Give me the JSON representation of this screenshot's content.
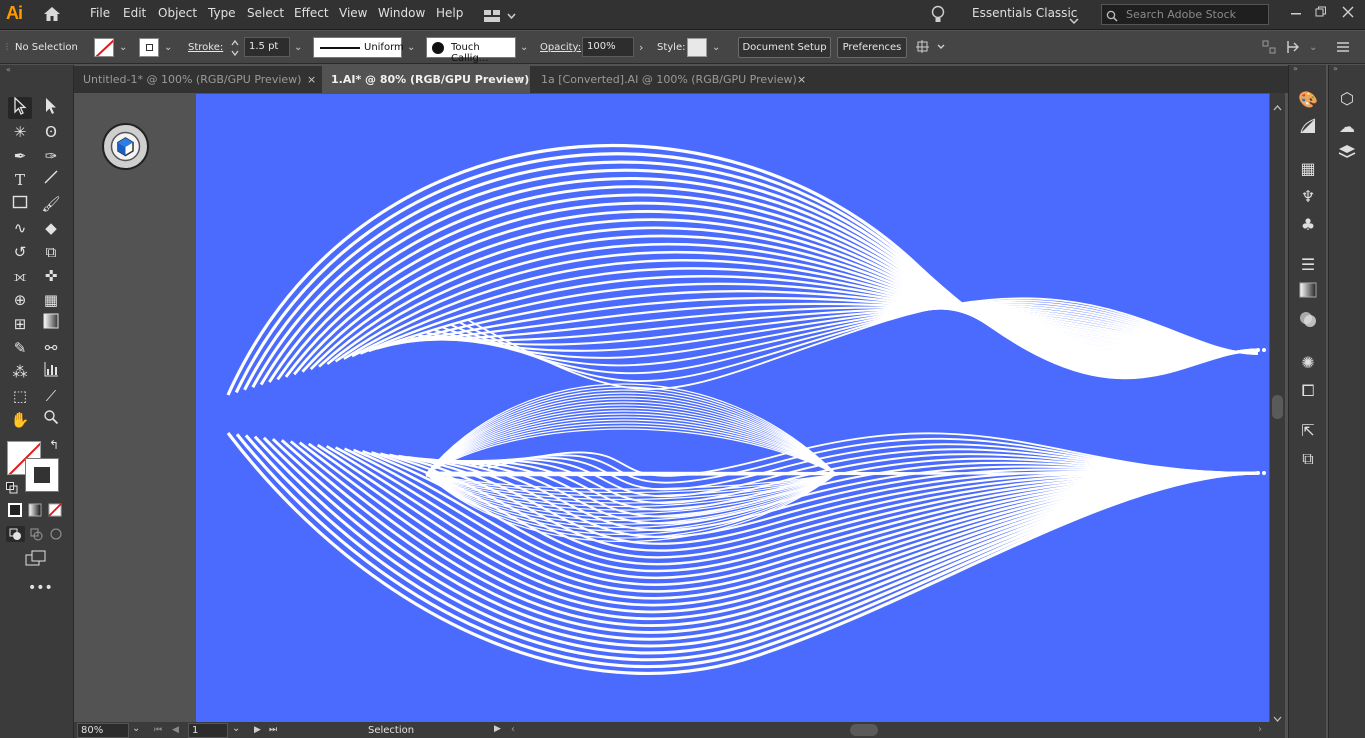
{
  "app": {
    "logo": "Ai",
    "workspace": "Essentials Classic"
  },
  "menu": [
    "File",
    "Edit",
    "Object",
    "Type",
    "Select",
    "Effect",
    "View",
    "Window",
    "Help"
  ],
  "search": {
    "placeholder": "Search Adobe Stock"
  },
  "control": {
    "selection_state": "No Selection",
    "stroke_label": "Stroke:",
    "stroke_weight": "1.5 pt",
    "profile": "Uniform",
    "brush": "Touch Callig...",
    "opacity_label": "Opacity:",
    "opacity": "100%",
    "style_label": "Style:",
    "document_setup": "Document Setup",
    "preferences": "Preferences"
  },
  "tabs": [
    {
      "label": "Untitled-1* @ 100% (RGB/GPU Preview)",
      "active": false
    },
    {
      "label": "1.AI* @ 80% (RGB/GPU Preview)",
      "active": true
    },
    {
      "label": "1a [Converted].AI @ 100% (RGB/GPU Preview)",
      "active": false
    }
  ],
  "tab_close_glyph": "×",
  "status": {
    "zoom": "80%",
    "artboard": "1",
    "tool": "Selection"
  },
  "colors": {
    "artboard": "#4b6bff",
    "accent_logo": "#ff9a00",
    "lines": "#ffffff"
  },
  "icons": {
    "tools": [
      "selection-tool-icon",
      "direct-selection-tool-icon",
      "magic-wand-icon",
      "lasso-icon",
      "pen-tool-icon",
      "curvature-tool-icon",
      "type-tool-icon",
      "line-segment-icon",
      "rectangle-tool-icon",
      "paintbrush-icon",
      "shaper-tool-icon",
      "eraser-icon",
      "rotate-tool-icon",
      "scale-tool-icon",
      "width-tool-icon",
      "puppet-warp-icon",
      "shape-builder-icon",
      "perspective-grid-icon",
      "mesh-tool-icon",
      "gradient-tool-icon",
      "eyedropper-icon",
      "blend-tool-icon",
      "symbol-sprayer-icon",
      "column-graph-icon",
      "artboard-tool-icon",
      "slice-tool-icon",
      "hand-tool-icon",
      "zoom-tool-icon"
    ],
    "dock": [
      "color-icon",
      "color-guide-icon",
      "swatches-icon",
      "brushes-icon",
      "symbols-icon",
      "stroke-icon",
      "gradient-icon",
      "transparency-icon",
      "appearance-icon",
      "graphic-styles-icon",
      "export-icon",
      "artboards-icon",
      "libraries-icon",
      "cc-libraries-icon",
      "layers-icon"
    ]
  }
}
